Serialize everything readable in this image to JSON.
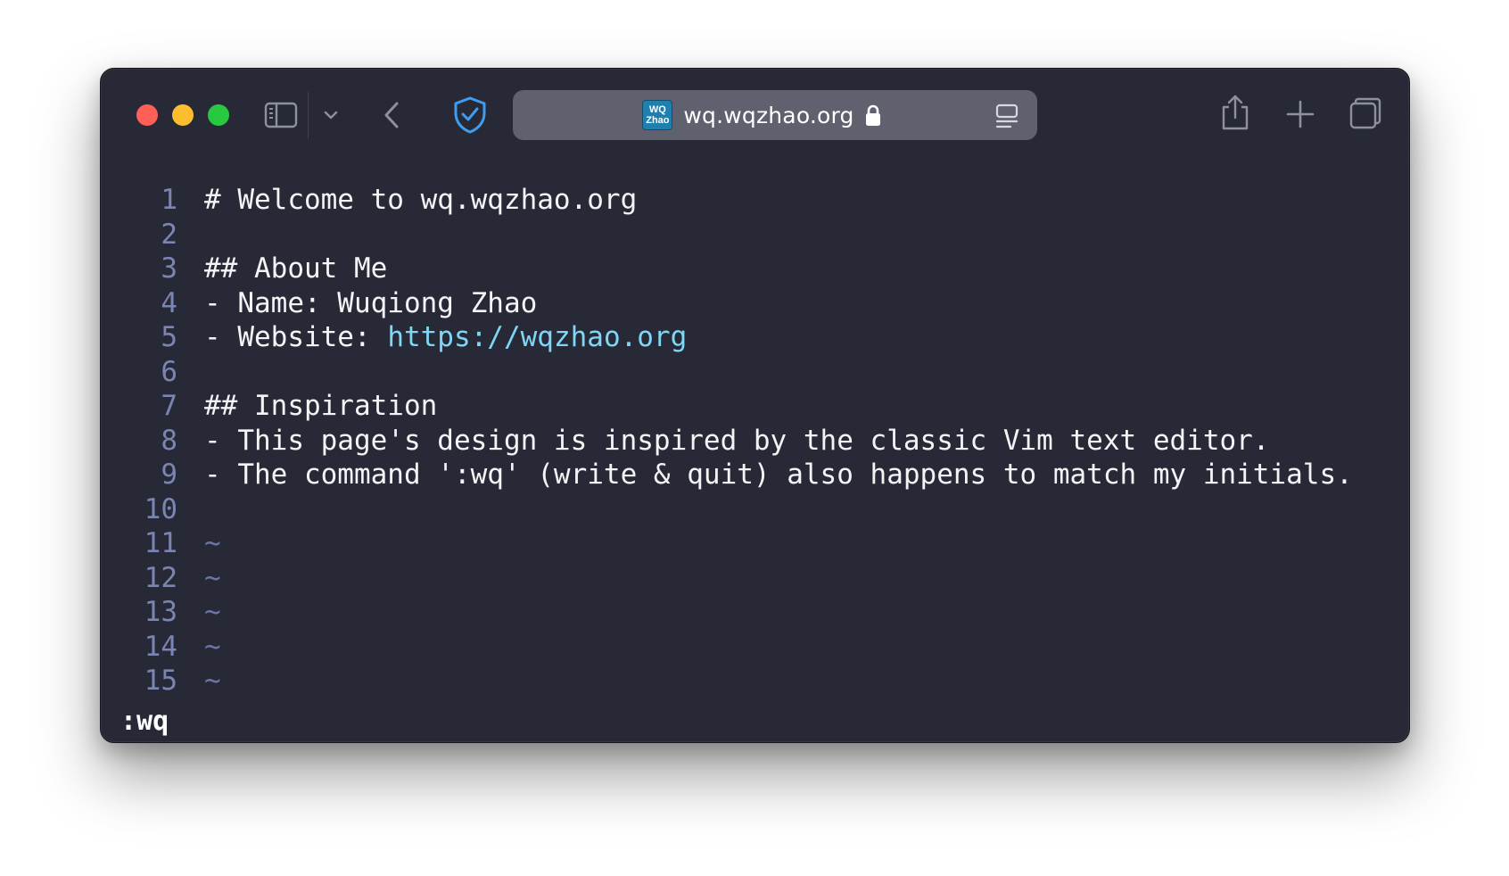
{
  "browser": {
    "url": "wq.wqzhao.org",
    "favicon_line1": "WQ",
    "favicon_line2": "Zhao",
    "accent_color": "#3f9cf0"
  },
  "editor": {
    "lines": [
      {
        "num": "1",
        "text": "# Welcome to wq.wqzhao.org"
      },
      {
        "num": "2",
        "text": ""
      },
      {
        "num": "3",
        "text": "## About Me"
      },
      {
        "num": "4",
        "text": "- Name: Wuqiong Zhao"
      },
      {
        "num": "5",
        "prefix": "- Website: ",
        "link": "https://wqzhao.org"
      },
      {
        "num": "6",
        "text": ""
      },
      {
        "num": "7",
        "text": "## Inspiration"
      },
      {
        "num": "8",
        "text": "- This page's design is inspired by the classic Vim text editor."
      },
      {
        "num": "9",
        "text": "- The command ':wq' (write & quit) also happens to match my initials."
      },
      {
        "num": "10",
        "text": ""
      },
      {
        "num": "11",
        "tilde": "~"
      },
      {
        "num": "12",
        "tilde": "~"
      },
      {
        "num": "13",
        "tilde": "~"
      },
      {
        "num": "14",
        "tilde": "~"
      },
      {
        "num": "15",
        "tilde": "~"
      }
    ],
    "command": ":wq"
  }
}
